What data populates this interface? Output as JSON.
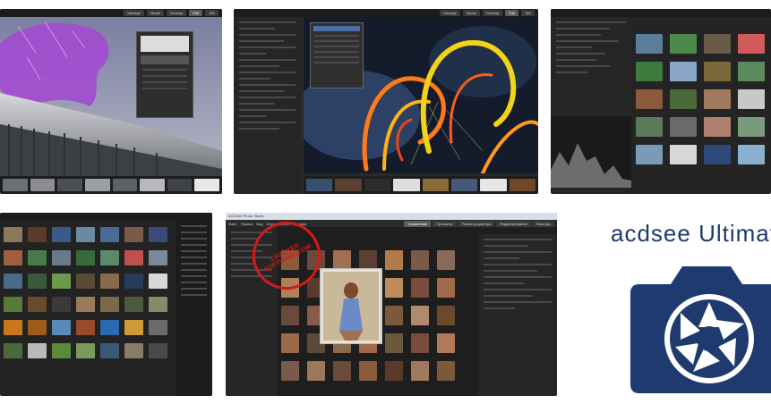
{
  "tiles": {
    "t1": {
      "tabs": [
        "Manage",
        "Media",
        "Develop",
        "Edit",
        "360"
      ],
      "active": "Edit"
    },
    "t2": {
      "tabs": [
        "Manage",
        "Media",
        "Develop",
        "Edit",
        "360"
      ],
      "active": "Edit"
    },
    "t5": {
      "title": "ACDSee Photo Studio",
      "watermark": "CRACKED SOFTWARE.COM",
      "menu": [
        "Файл",
        "Правка",
        "Вид",
        "Инструменты",
        "Справка"
      ],
      "tabs": [
        "Управление",
        "Просмотр",
        "Режим редактора",
        "Редактирование",
        "Фильтры"
      ]
    },
    "t6": {
      "logo_text": "acdsee Ultimate"
    }
  }
}
